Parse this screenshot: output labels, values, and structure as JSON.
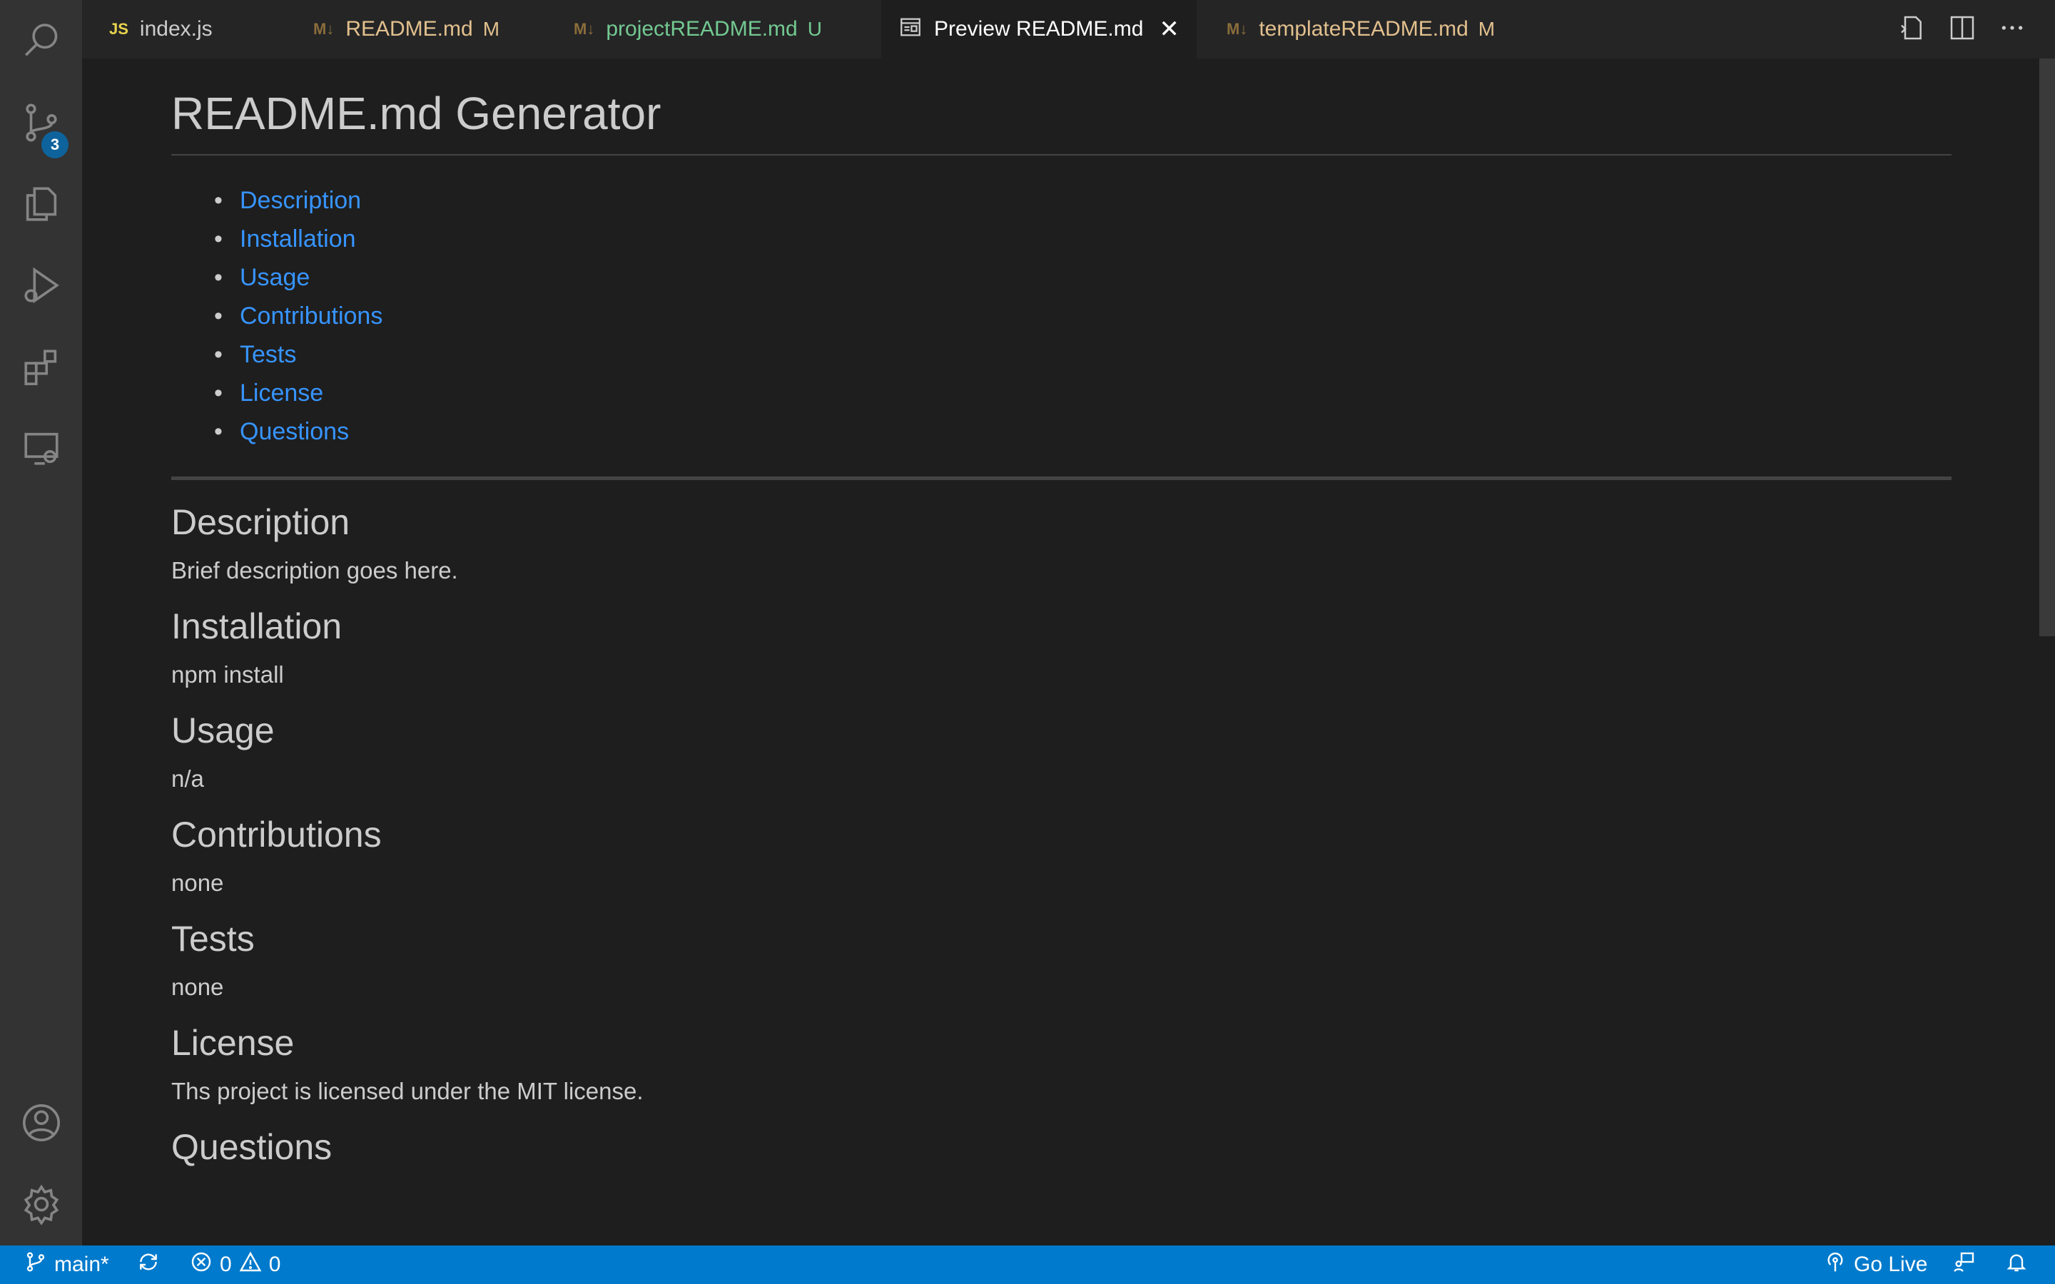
{
  "activity_bar": {
    "icons": [
      "search-icon",
      "source-control-icon",
      "explorer-icon",
      "run-debug-icon",
      "extensions-icon",
      "remote-explorer-icon",
      "account-icon",
      "settings-gear-icon"
    ],
    "source_control_badge": "3"
  },
  "tabs": [
    {
      "icon": "JS",
      "label": "index.js",
      "status": "",
      "color": "#cccccc",
      "icon_color": "#e8d44d"
    },
    {
      "icon": "M↓",
      "label": "README.md",
      "status": "M",
      "color": "#e2c08d",
      "icon_color": "#8a6d3b"
    },
    {
      "icon": "M↓",
      "label": "projectREADME.md",
      "status": "U",
      "color": "#73c991",
      "icon_color": "#8a6d3b"
    },
    {
      "icon": "preview-icon",
      "label": "Preview README.md",
      "status": "",
      "color": "#ffffff",
      "active": true
    },
    {
      "icon": "M↓",
      "label": "templateREADME.md",
      "status": "M",
      "color": "#e2c08d",
      "icon_color": "#8a6d3b"
    }
  ],
  "tab_actions": [
    "open-source-icon",
    "split-editor-icon",
    "more-actions-icon"
  ],
  "preview": {
    "title": "README.md Generator",
    "toc": [
      "Description",
      "Installation",
      "Usage",
      "Contributions",
      "Tests",
      "License",
      "Questions"
    ],
    "sections": [
      {
        "heading": "Description",
        "text": "Brief description goes here."
      },
      {
        "heading": "Installation",
        "text": "npm install"
      },
      {
        "heading": "Usage",
        "text": "n/a"
      },
      {
        "heading": "Contributions",
        "text": "none"
      },
      {
        "heading": "Tests",
        "text": "none"
      },
      {
        "heading": "License",
        "text": "Ths project is licensed under the MIT license."
      },
      {
        "heading": "Questions",
        "text": ""
      }
    ]
  },
  "status_bar": {
    "branch": "main*",
    "errors": "0",
    "warnings": "0",
    "go_live": "Go Live"
  },
  "colors": {
    "activity_bar": "#333333",
    "editor_bg": "#1e1e1e",
    "tab_bar": "#252526",
    "status_bar": "#007acc",
    "link": "#3794ff",
    "modified": "#e2c08d",
    "untracked": "#73c991"
  }
}
